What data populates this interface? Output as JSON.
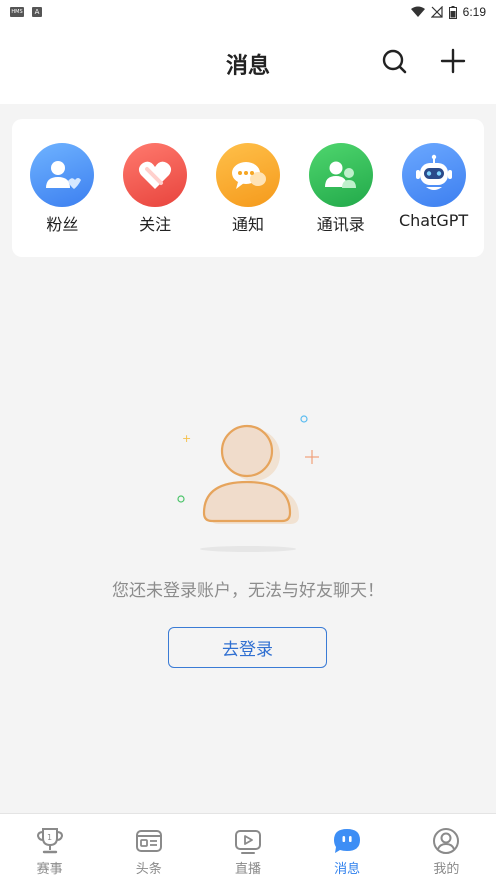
{
  "status_bar": {
    "time": "6:19",
    "left_icons": [
      "hms-icon",
      "a-icon"
    ],
    "hms_label": "HMS",
    "a_label": "A"
  },
  "header": {
    "title": "消息"
  },
  "shortcuts": [
    {
      "label": "粉丝",
      "icon": "fans-icon",
      "color": "#4a90f0"
    },
    {
      "label": "关注",
      "icon": "follow-heart-icon",
      "color": "#f0504a"
    },
    {
      "label": "通知",
      "icon": "notice-bubble-icon",
      "color": "#f5a623"
    },
    {
      "label": "通讯录",
      "icon": "contacts-icon",
      "color": "#2fbf5a"
    },
    {
      "label": "ChatGPT",
      "icon": "robot-icon",
      "color": "#3d8ef5"
    }
  ],
  "empty_state": {
    "message": "您还未登录账户，无法与好友聊天！",
    "login_button": "去登录"
  },
  "tab_bar": {
    "items": [
      {
        "label": "赛事",
        "icon": "trophy-icon",
        "active": false
      },
      {
        "label": "头条",
        "icon": "news-icon",
        "active": false
      },
      {
        "label": "直播",
        "icon": "live-play-icon",
        "active": false
      },
      {
        "label": "消息",
        "icon": "message-icon",
        "active": true
      },
      {
        "label": "我的",
        "icon": "profile-icon",
        "active": false
      }
    ]
  },
  "colors": {
    "accent": "#2f80ed",
    "background": "#f4f4f4",
    "illustration": "#e6a45c"
  }
}
